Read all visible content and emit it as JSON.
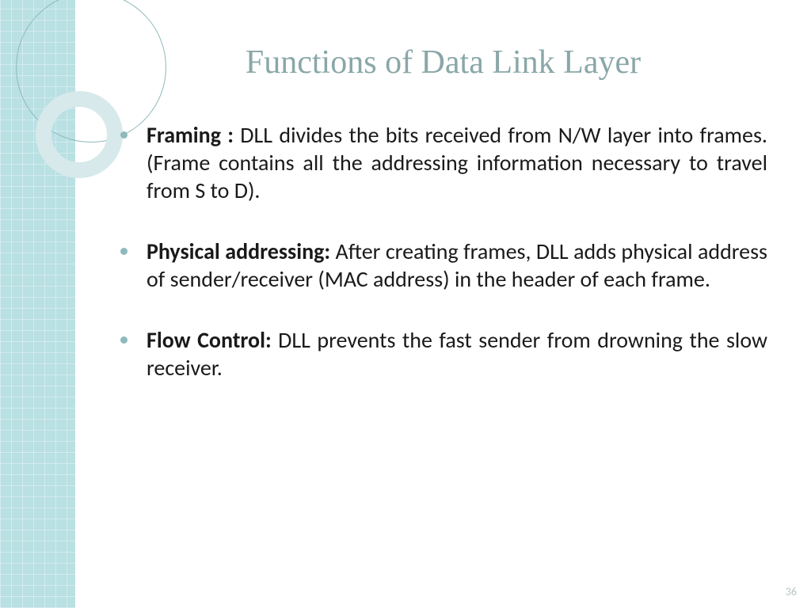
{
  "title": "Functions of Data Link Layer",
  "bullets": [
    {
      "label": "Framing :",
      "text": " DLL divides the bits received from N/W layer into frames. (Frame contains all the addressing information necessary to travel from S to D)."
    },
    {
      "label": "Physical addressing:",
      "text": " After creating frames, DLL adds physical address of sender/receiver (MAC address) in the header of each frame."
    },
    {
      "label": "Flow Control:",
      "text": " DLL prevents the fast sender from drowning the slow receiver."
    }
  ],
  "page_number": "36"
}
